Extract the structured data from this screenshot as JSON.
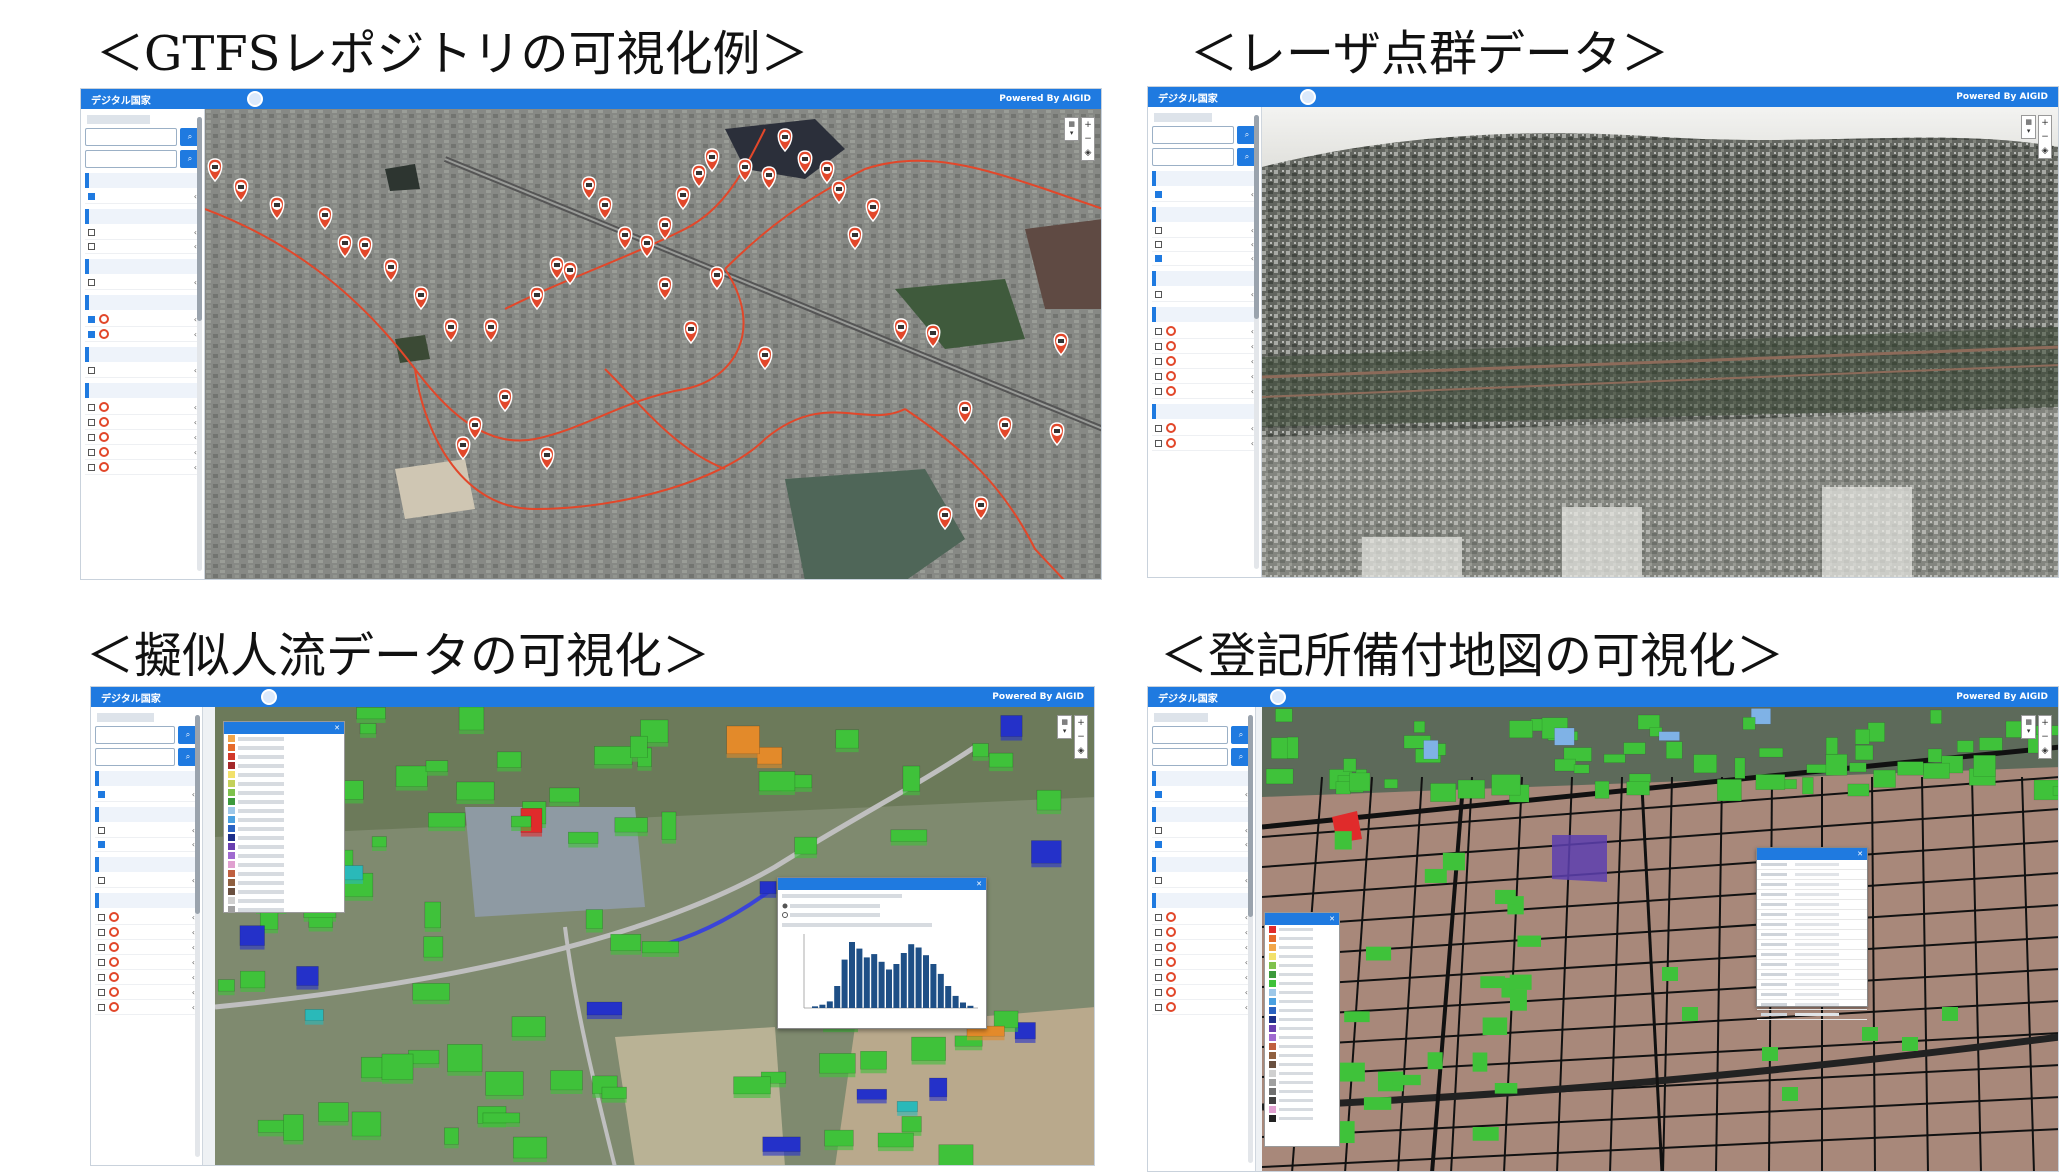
{
  "captions": {
    "gtfs": "＜GTFSレポジトリの可視化例＞",
    "laser": "＜レーザ点群データ＞",
    "pseudo": "＜擬似人流データの可視化＞",
    "registry": "＜登記所備付地図の可視化＞"
  },
  "apps": {
    "gtfs": {
      "title": "デジタル国家",
      "powered": "Powered By AIGID"
    },
    "laser": {
      "title": "デジタル国家",
      "powered": "Powered By AIGID"
    },
    "pseudo": {
      "title": "デジタル国家",
      "powered": "Powered By AIGID"
    },
    "registry": {
      "title": "デジタル国家",
      "powered": "Powered By AIGID"
    }
  },
  "colors": {
    "accent": "#1f7ae0",
    "route": "#e2472a",
    "building_green": "#3fc23a",
    "building_blue": "#2431c9",
    "building_orange": "#e38a2a"
  },
  "icons": {
    "search_logo": "search-globe-icon",
    "marker": "bus-stop-marker-icon",
    "close": "close-icon"
  }
}
